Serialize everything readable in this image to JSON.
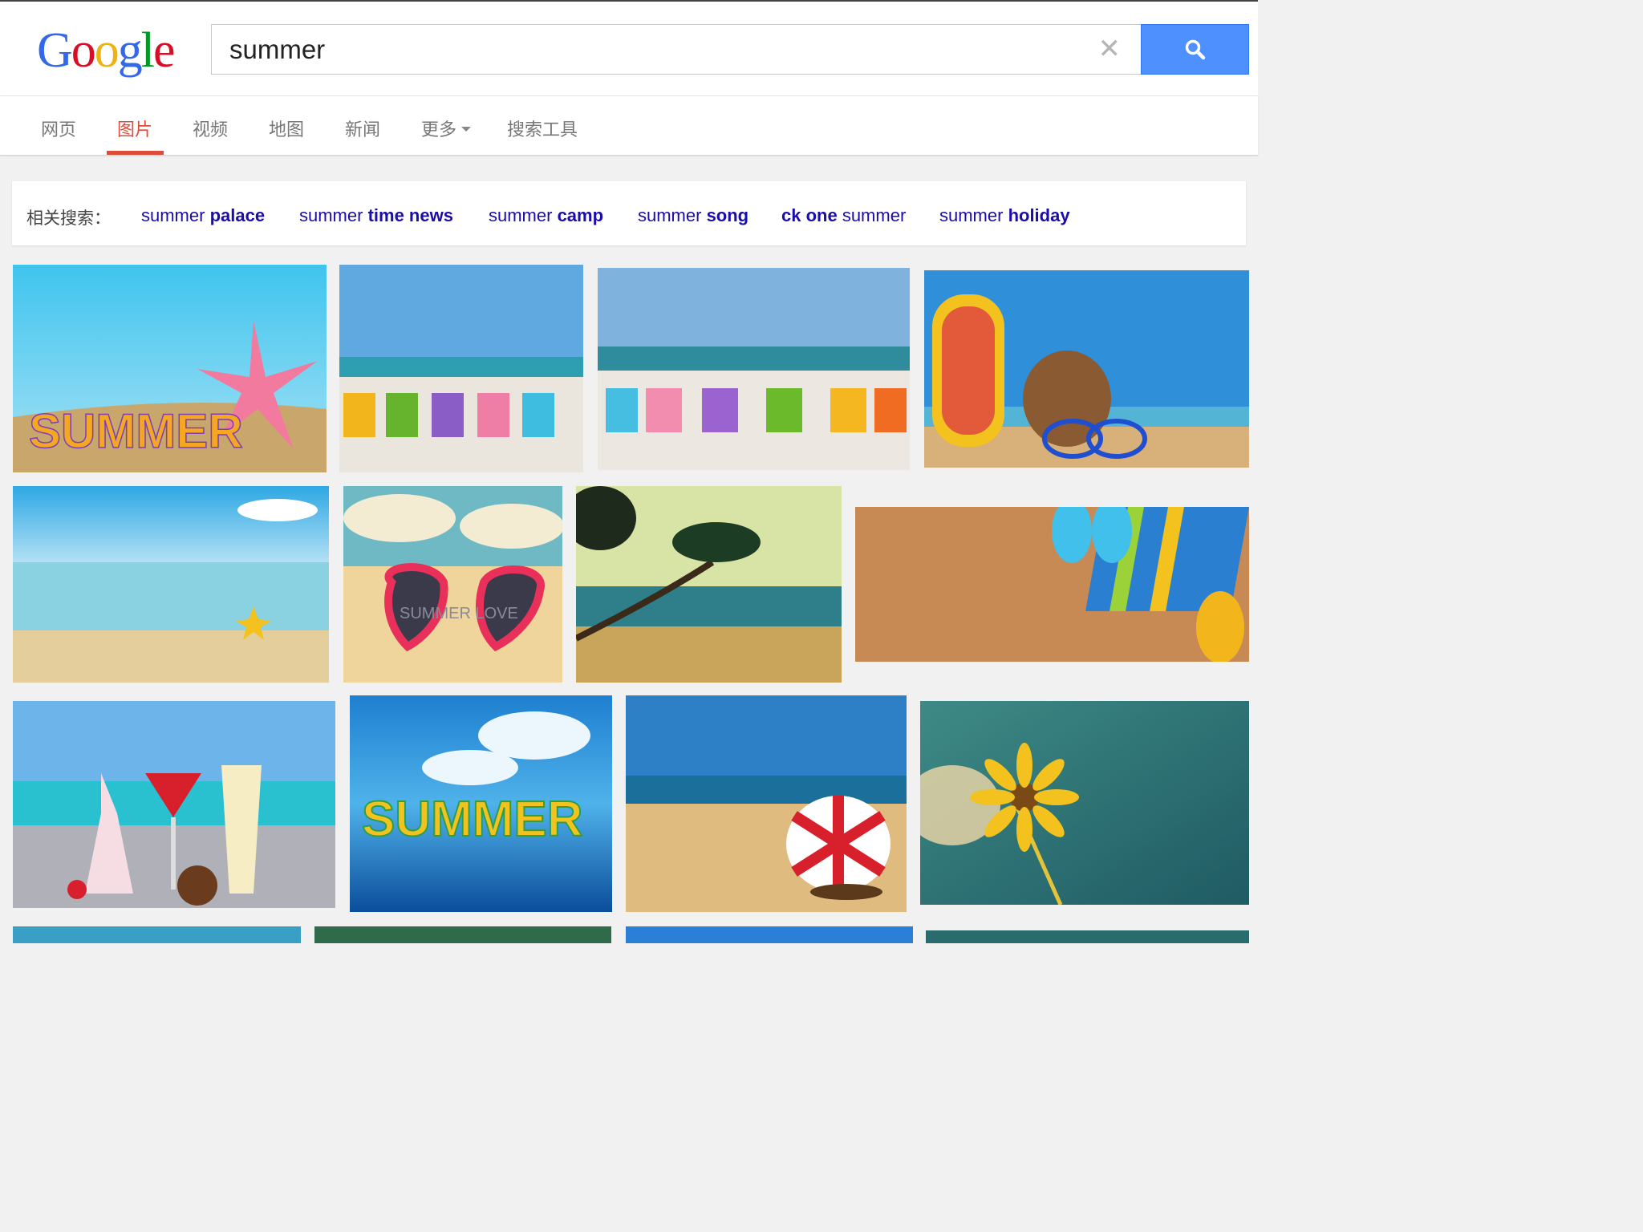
{
  "logo": {
    "text": "Google",
    "letters": [
      "G",
      "o",
      "o",
      "g",
      "l",
      "e"
    ],
    "colors": [
      "#3369e8",
      "#d50f25",
      "#eeb211",
      "#3369e8",
      "#009925",
      "#d50f25"
    ]
  },
  "search": {
    "query": "summer",
    "clear_icon": "close-icon",
    "button_icon": "search-icon",
    "button_color": "#4d90fe"
  },
  "tabs": [
    {
      "label": "网页"
    },
    {
      "label": "图片",
      "active": true
    },
    {
      "label": "视频"
    },
    {
      "label": "地图"
    },
    {
      "label": "新闻"
    },
    {
      "label": "更多"
    },
    {
      "label": "搜索工具"
    }
  ],
  "related": {
    "label": "相关搜索：",
    "items": [
      {
        "plain": "summer ",
        "bold": "palace"
      },
      {
        "plain": "summer ",
        "bold": "time news"
      },
      {
        "plain": "summer ",
        "bold": "camp"
      },
      {
        "plain": "summer ",
        "bold": "song"
      },
      {
        "bold": "ck one",
        "plain": " summer"
      },
      {
        "plain": "summer ",
        "bold": "holiday"
      }
    ]
  },
  "images": [
    {
      "name": "summer-starfish-letters-image",
      "overlay_text": "SUMMER"
    },
    {
      "name": "beach-chairs-image-1",
      "overlay_text": ""
    },
    {
      "name": "beach-chairs-image-2",
      "overlay_text": ""
    },
    {
      "name": "flip-flops-coconut-image",
      "overlay_text": ""
    },
    {
      "name": "calm-sea-starfish-image",
      "overlay_text": ""
    },
    {
      "name": "heart-sunglasses-image",
      "overlay_text": "SUMMER LOVE"
    },
    {
      "name": "palm-tree-beach-image",
      "overlay_text": ""
    },
    {
      "name": "sand-flip-flops-towel-image",
      "overlay_text": ""
    },
    {
      "name": "cocktails-beach-image",
      "overlay_text": ""
    },
    {
      "name": "summer-3d-letters-image",
      "overlay_text": "SUMMER"
    },
    {
      "name": "beach-umbrella-image",
      "overlay_text": ""
    },
    {
      "name": "yellow-flower-sky-image",
      "overlay_text": ""
    }
  ],
  "colors": {
    "link": "#1a0dab",
    "active_tab": "#dd4b39",
    "background": "#f1f1f1"
  }
}
